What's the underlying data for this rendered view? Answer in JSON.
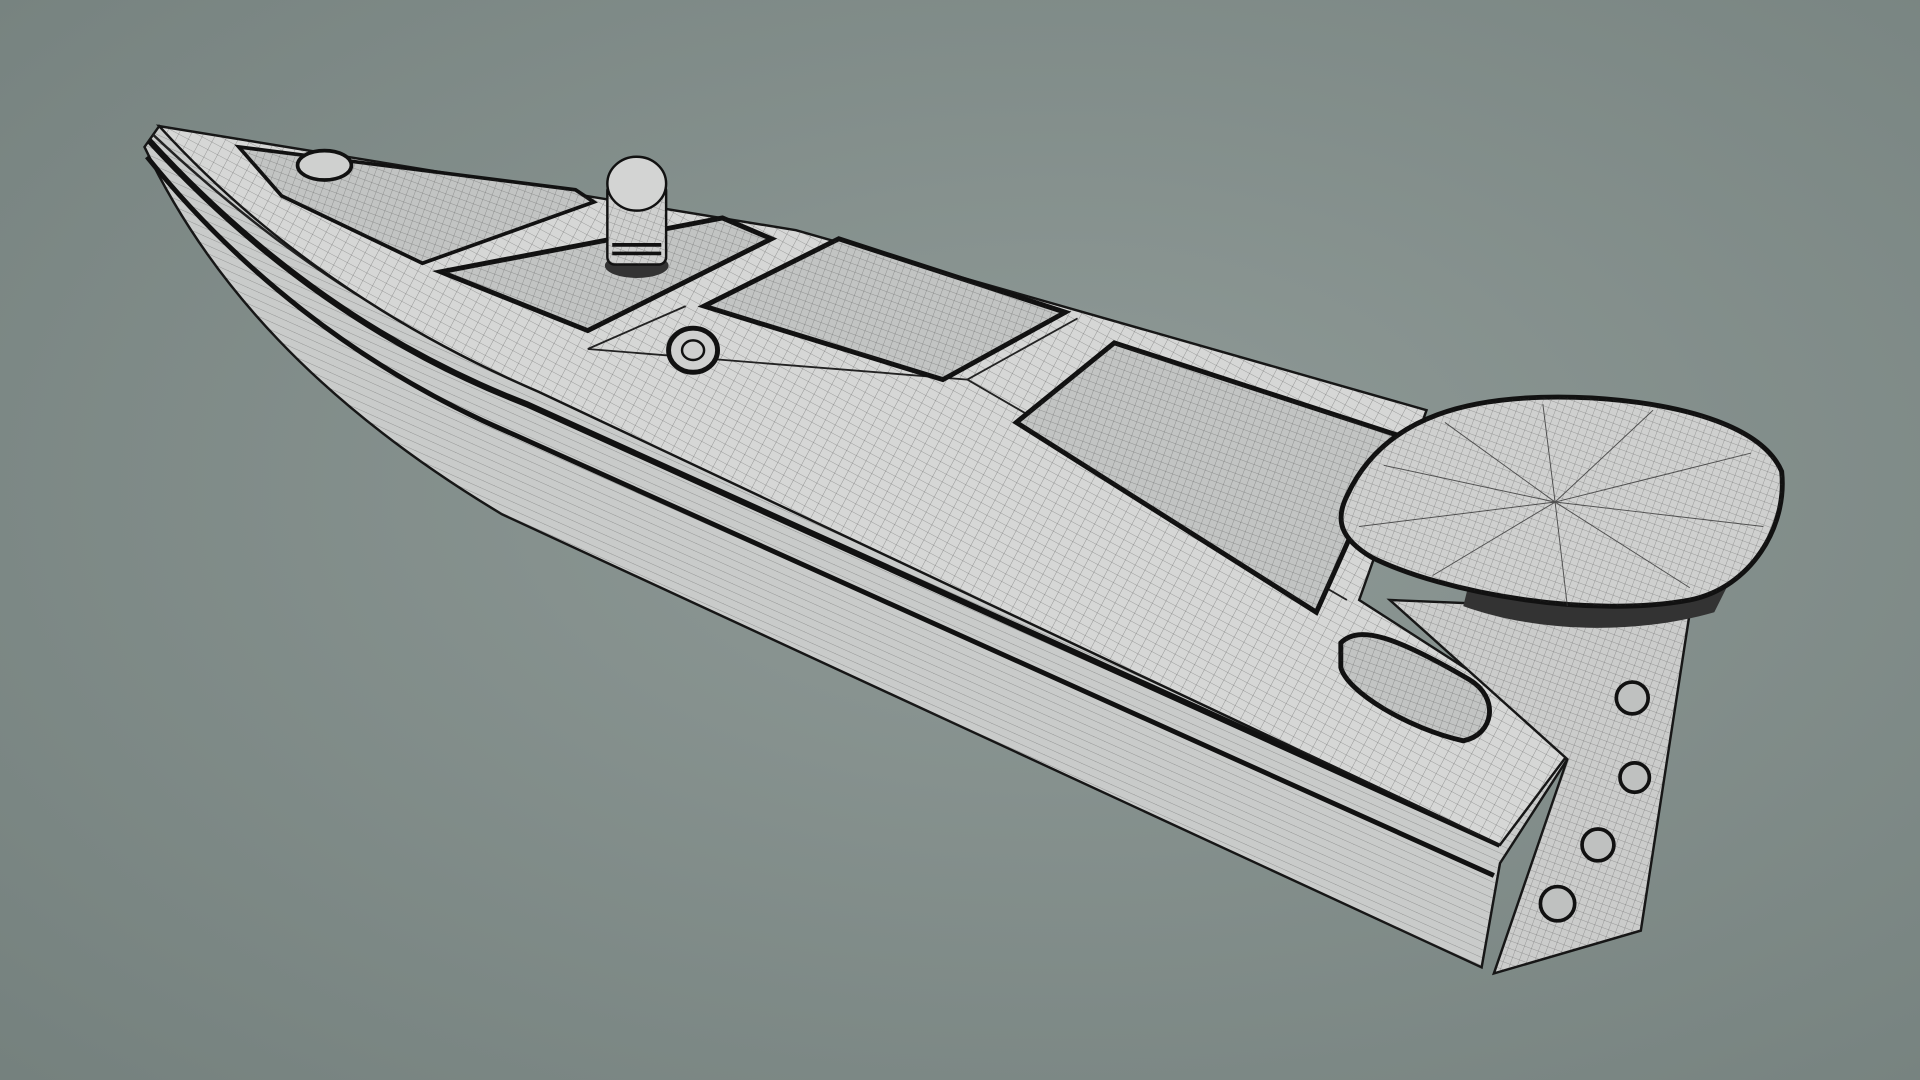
{
  "colors": {
    "background_center": "#8f9a97",
    "background_edge": "#74807d",
    "hull_fill": "#c9cbca",
    "deck_fill": "#d6d7d6",
    "panel_fill": "#c2c4c3",
    "wire": "#3a3a3a",
    "outline": "#161616"
  }
}
